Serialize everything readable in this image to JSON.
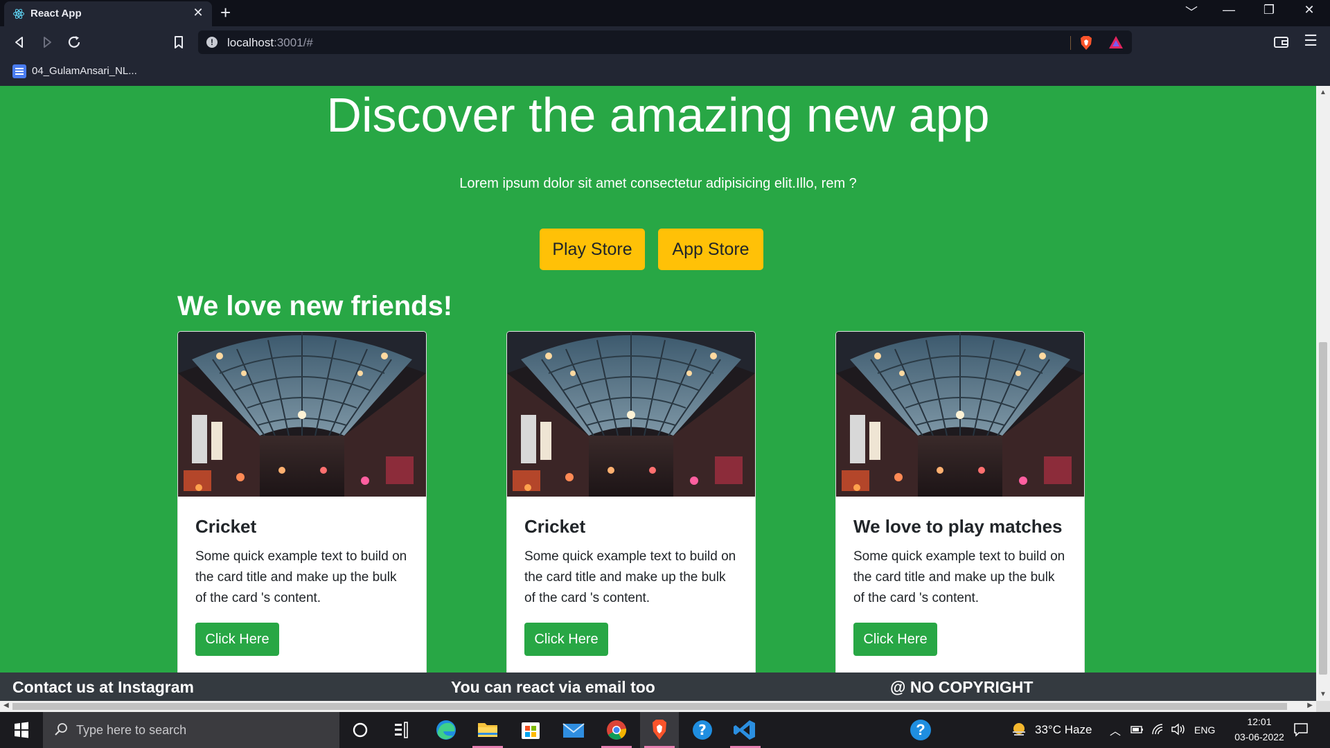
{
  "browser": {
    "tab_title": "React App",
    "tab_close": "✕",
    "new_tab": "+",
    "url_host": "localhost",
    "url_rest": ":3001/#",
    "bookmark_label": "04_GulamAnsari_NL...",
    "window_controls": [
      "﹀",
      "—",
      "❐",
      "✕"
    ]
  },
  "hero": {
    "title": "Discover the amazing new app",
    "lead": "Lorem ipsum dolor sit amet consectetur adipisicing elit.Illo, rem ?",
    "play_store_label": "Play Store",
    "app_store_label": "App Store"
  },
  "friends": {
    "heading": "We love new friends!",
    "cards": [
      {
        "title": "Cricket",
        "text": "Some quick example text to build on the card title and make up the bulk of the card 's content.",
        "button": "Click Here"
      },
      {
        "title": "Cricket",
        "text": "Some quick example text to build on the card title and make up the bulk of the card 's content.",
        "button": "Click Here"
      },
      {
        "title": "We love to play matches",
        "text": "Some quick example text to build on the card title and make up the bulk of the card 's content.",
        "button": "Click Here"
      }
    ]
  },
  "footer": {
    "contact": "Contact us at Instagram",
    "email": "You can react via email too",
    "copyright": "@ NO COPYRIGHT"
  },
  "taskbar": {
    "search_placeholder": "Type here to search",
    "weather": "33°C  Haze",
    "language": "ENG",
    "time": "12:01",
    "date": "03-06-2022"
  },
  "colors": {
    "page_bg": "#28a745",
    "store_button": "#ffc107",
    "card_button": "#28a745",
    "footer_bg": "#343a40",
    "browser_dark": "#222633"
  }
}
